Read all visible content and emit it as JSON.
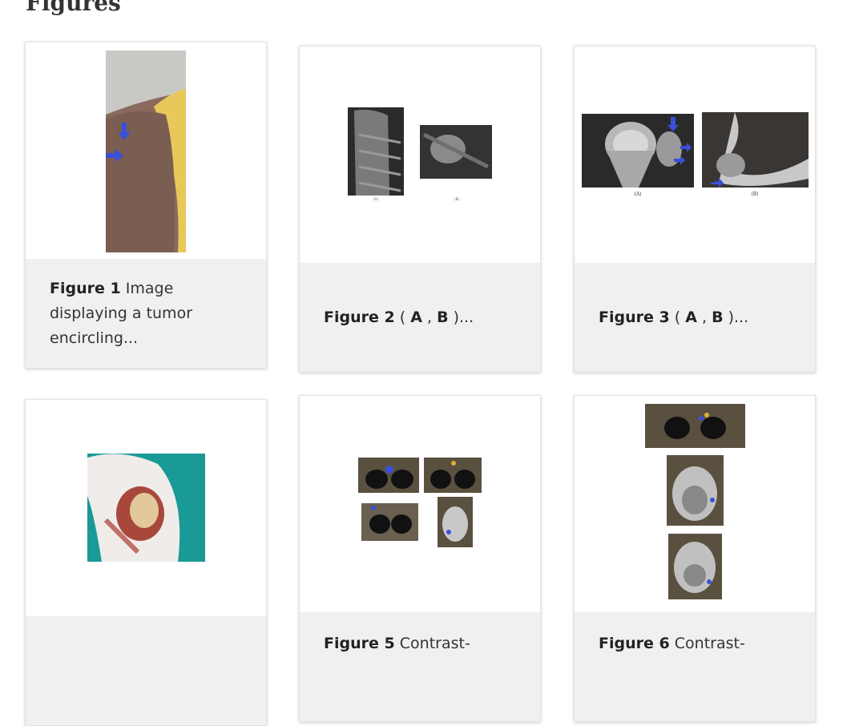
{
  "section": {
    "title": "Figures"
  },
  "figures": [
    {
      "label": "Figure 1",
      "caption": " Image displaying a tumor encircling..."
    },
    {
      "label": "Figure 2",
      "caption_pre": " ( ",
      "a": "A",
      "sep": " , ",
      "b": "B",
      "caption_post": " )..."
    },
    {
      "label": "Figure 3",
      "caption_pre": " ( ",
      "a": "A",
      "sep": " , ",
      "b": "B",
      "caption_post": " )..."
    },
    {
      "label": "",
      "caption": ""
    },
    {
      "label": "Figure 5",
      "caption": " Contrast-"
    },
    {
      "label": "Figure 6",
      "caption": " Contrast-"
    }
  ],
  "colors": {
    "caption_bg": "#f0f0f0",
    "arrow": "#3a4fd8"
  }
}
